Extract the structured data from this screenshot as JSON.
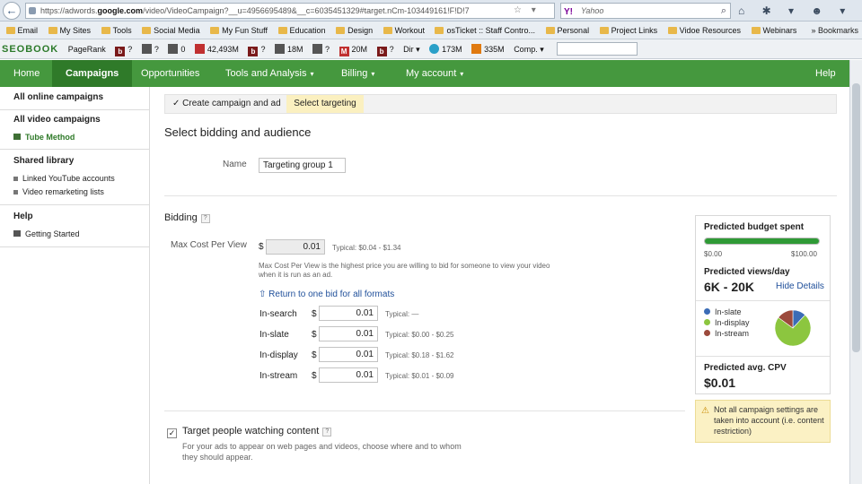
{
  "browser": {
    "url_prefix": "https://adwords.",
    "url_domain": "google.com",
    "url_rest": "/video/VideoCampaign?__u=4956695489&__c=6035451329#target.nCm-103449161!F!D!7",
    "search_placeholder": "Yahoo",
    "search_logo": "Y!",
    "tools_glyphs": "☆ ▾ C",
    "icons": "⌂ ✱ ▾ ☻ ▾ ✱ ▾"
  },
  "bookmarks": [
    {
      "label": "Email"
    },
    {
      "label": "My Sites"
    },
    {
      "label": "Tools"
    },
    {
      "label": "Social Media"
    },
    {
      "label": "My Fun Stuff"
    },
    {
      "label": "Education"
    },
    {
      "label": "Design"
    },
    {
      "label": "Workout"
    },
    {
      "label": "osTicket :: Staff Contro..."
    },
    {
      "label": "Personal"
    },
    {
      "label": "Project Links"
    },
    {
      "label": "Vidoe Resources"
    },
    {
      "label": "Webinars"
    }
  ],
  "bookmarks_right": "» Bookmarks",
  "seotoolbar": {
    "logo": "SEOBOOK",
    "items": [
      "PageRank",
      "?",
      "?",
      "0",
      "42,493M",
      "?",
      "18M",
      "?",
      "20M",
      "?",
      "Dir ▾",
      "173M",
      "335M",
      "Comp. ▾"
    ]
  },
  "nav": {
    "items": [
      "Home",
      "Campaigns",
      "Opportunities",
      "Tools and Analysis",
      "Billing",
      "My account"
    ],
    "help": "Help",
    "caret": "▾"
  },
  "sidebar": {
    "all_online": "All online campaigns",
    "all_video": "All video campaigns",
    "tube_method": "Tube Method",
    "shared_library": "Shared library",
    "linked_youtube": "Linked YouTube accounts",
    "video_remarketing": "Video remarketing lists",
    "help": "Help",
    "getting_started": "Getting Started"
  },
  "steps": {
    "step1": "✓ Create campaign and ad",
    "step2": "Select targeting"
  },
  "form": {
    "section_title": "Select bidding and audience",
    "name_label": "Name",
    "name_value": "Targeting group 1",
    "bidding_label": "Bidding",
    "help_glyph": "?",
    "max_cpv_label": "Max Cost Per View",
    "currency": "$",
    "max_cpv_value": "0.01",
    "max_cpv_typical": "Typical: $0.04 - $1.34",
    "max_cpv_desc_1": "Max Cost Per View is the highest price you are willing to bid for someone to view your video",
    "max_cpv_desc_2": "when it is run as an ad.",
    "return_link": "⇧ Return to one bid for all formats",
    "formats": [
      {
        "label": "In-search",
        "value": "0.01",
        "typical": "Typical: —"
      },
      {
        "label": "In-slate",
        "value": "0.01",
        "typical": "Typical: $0.00 - $0.25"
      },
      {
        "label": "In-display",
        "value": "0.01",
        "typical": "Typical: $0.18 - $1.62"
      },
      {
        "label": "In-stream",
        "value": "0.01",
        "typical": "Typical: $0.01 - $0.09"
      }
    ],
    "target_check": "✓",
    "target_label": "Target people watching content",
    "target_desc_1": "For your ads to appear on web pages and videos, choose where and to whom",
    "target_desc_2": "they should appear."
  },
  "prediction": {
    "budget_title": "Predicted budget spent",
    "budget_fraction": 1.0,
    "budget_min": "$0.00",
    "budget_max": "$100.00",
    "views_title": "Predicted views/day",
    "views_value": "6K - 20K",
    "hide_details": "Hide Details",
    "legend": [
      {
        "label": "In-slate",
        "color": "#3b6cb6",
        "share": 0.12
      },
      {
        "label": "In-display",
        "color": "#8cc63f",
        "share": 0.73
      },
      {
        "label": "In-stream",
        "color": "#9c4a3c",
        "share": 0.15
      }
    ],
    "cpv_title": "Predicted avg. CPV",
    "cpv_value": "$0.01",
    "warning_icon": "⚠",
    "warning": "Not all campaign settings are taken into account (i.e. content restriction)"
  }
}
